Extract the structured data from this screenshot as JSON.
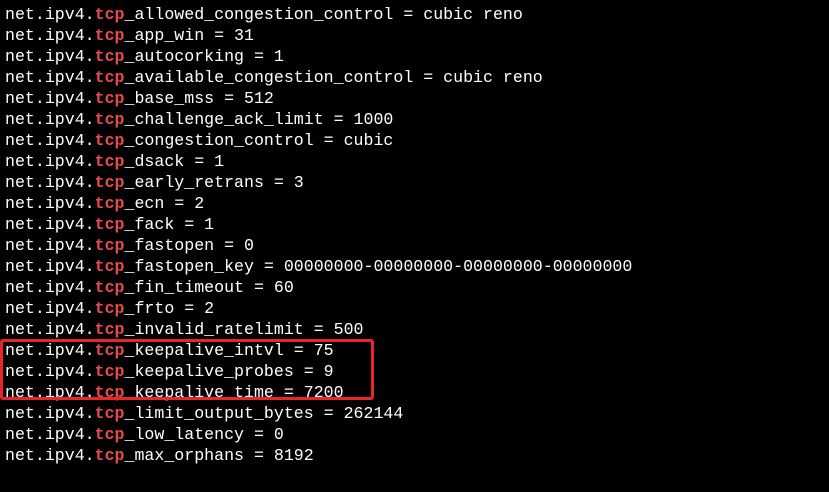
{
  "terminal": {
    "prefix": "net.ipv4.",
    "keyword": "tcp",
    "lines": [
      {
        "suffix": "_allowed_congestion_control = cubic reno"
      },
      {
        "suffix": "_app_win = 31"
      },
      {
        "suffix": "_autocorking = 1"
      },
      {
        "suffix": "_available_congestion_control = cubic reno"
      },
      {
        "suffix": "_base_mss = 512"
      },
      {
        "suffix": "_challenge_ack_limit = 1000"
      },
      {
        "suffix": "_congestion_control = cubic"
      },
      {
        "suffix": "_dsack = 1"
      },
      {
        "suffix": "_early_retrans = 3"
      },
      {
        "suffix": "_ecn = 2"
      },
      {
        "suffix": "_fack = 1"
      },
      {
        "suffix": "_fastopen = 0"
      },
      {
        "suffix": "_fastopen_key = 00000000-00000000-00000000-00000000"
      },
      {
        "suffix": "_fin_timeout = 60"
      },
      {
        "suffix": "_frto = 2"
      },
      {
        "suffix": "_invalid_ratelimit = 500"
      },
      {
        "suffix": "_keepalive_intvl = 75"
      },
      {
        "suffix": "_keepalive_probes = 9"
      },
      {
        "suffix": "_keepalive_time = 7200"
      },
      {
        "suffix": "_limit_output_bytes = 262144"
      },
      {
        "suffix": "_low_latency = 0"
      },
      {
        "suffix": "_max_orphans = 8192"
      }
    ]
  },
  "colors": {
    "background": "#000000",
    "text": "#ffffff",
    "keyword": "#e84a4a",
    "highlight_border": "#e8262a"
  }
}
